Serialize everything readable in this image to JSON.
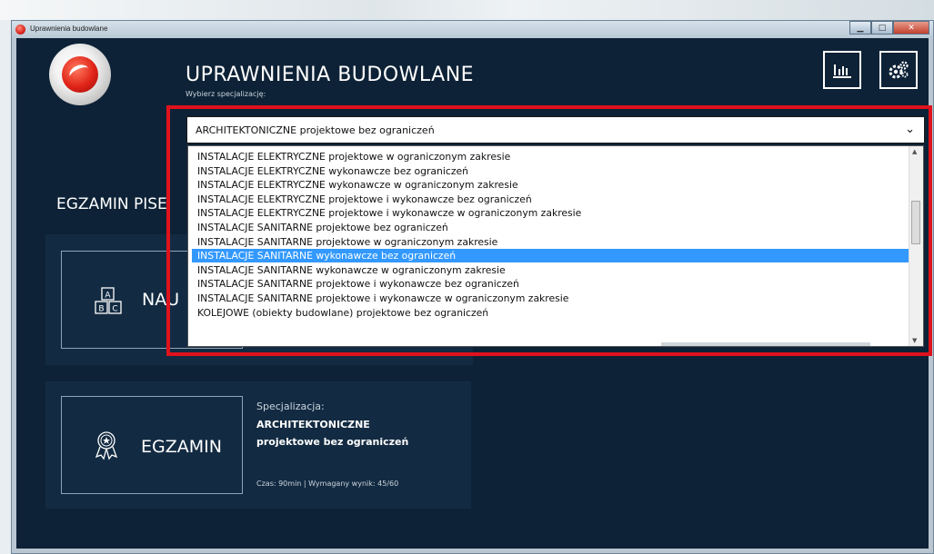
{
  "window": {
    "title": "Uprawnienia budowlane"
  },
  "header": {
    "app_title": "UPRAWNIENIA BUDOWLANE",
    "subtitle": "Wybierz specjalizację:"
  },
  "toolbar": {
    "stats_icon": "bar-chart-icon",
    "settings_icon": "gears-icon"
  },
  "dropdown": {
    "selected_value": "ARCHITEKTONICZNE projektowe bez ograniczeń",
    "options": [
      "INSTALACJE ELEKTRYCZNE projektowe w ograniczonym zakresie",
      "INSTALACJE ELEKTRYCZNE wykonawcze bez ograniczeń",
      "INSTALACJE ELEKTRYCZNE wykonawcze w ograniczonym zakresie",
      "INSTALACJE ELEKTRYCZNE projektowe i wykonawcze bez ograniczeń",
      "INSTALACJE ELEKTRYCZNE projektowe i wykonawcze w ograniczonym zakresie",
      "INSTALACJE SANITARNE projektowe bez ograniczeń",
      "INSTALACJE SANITARNE projektowe w ograniczonym zakresie",
      "INSTALACJE SANITARNE wykonawcze bez ograniczeń",
      "INSTALACJE SANITARNE wykonawcze w ograniczonym zakresie",
      "INSTALACJE SANITARNE projektowe i wykonawcze bez ograniczeń",
      "INSTALACJE SANITARNE projektowe i wykonawcze w ograniczonym zakresie",
      "KOLEJOWE (obiekty budowlane) projektowe bez ograniczeń"
    ],
    "highlighted_option": "INSTALACJE SANITARNE wykonawcze bez ograniczeń"
  },
  "main": {
    "section_title": "EGZAMIN PISE",
    "learn_label": "NAU",
    "exam_label": "EGZAMIN",
    "spec_label": "Specjalizacja:",
    "spec_name": "ARCHITEKTONICZNE",
    "spec_desc": "projektowe bez ograniczeń",
    "meta": "Czas: 90min | Wymagany wynik: 45/60"
  },
  "colors": {
    "background": "#0d2236",
    "panel": "#132b42",
    "highlight_border": "#e0121c",
    "selected_option": "#3399ff"
  }
}
